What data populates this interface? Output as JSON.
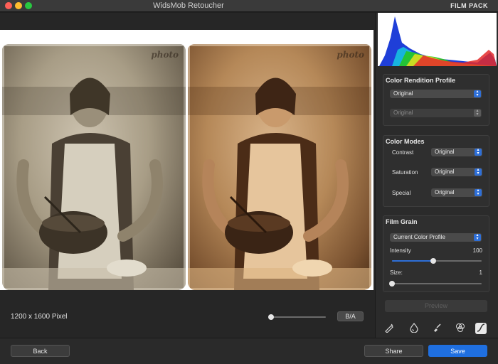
{
  "window": {
    "title": "WidsMob Retoucher",
    "mode_label": "FILM PACK"
  },
  "photo": {
    "watermark": "photo"
  },
  "status": {
    "dimensions": "1200 x 1600 Pixel",
    "ba_label": "B/A",
    "zoom": 0
  },
  "panel": {
    "color_rendition": {
      "title": "Color Rendition Profile",
      "primary": "Original",
      "secondary": "Original"
    },
    "color_modes": {
      "title": "Color Modes",
      "rows": [
        {
          "label": "Contrast",
          "value": "Original"
        },
        {
          "label": "Saturation",
          "value": "Original"
        },
        {
          "label": "Special",
          "value": "Original"
        }
      ]
    },
    "film_grain": {
      "title": "Film Grain",
      "profile": "Current Color Profile",
      "intensity_label": "Intensity",
      "intensity_value": "100",
      "intensity_fraction": 0.46,
      "size_label": "Size:",
      "size_value": "1",
      "size_fraction": 0.0
    },
    "preview_label": "Preview",
    "tools": [
      "brush-icon",
      "water-drop-icon",
      "paint-brush-icon",
      "color-circles-icon",
      "curve-icon"
    ]
  },
  "footer": {
    "back": "Back",
    "share": "Share",
    "save": "Save"
  },
  "colors": {
    "accent": "#1f6fe0",
    "background": "#1e1e1e"
  }
}
